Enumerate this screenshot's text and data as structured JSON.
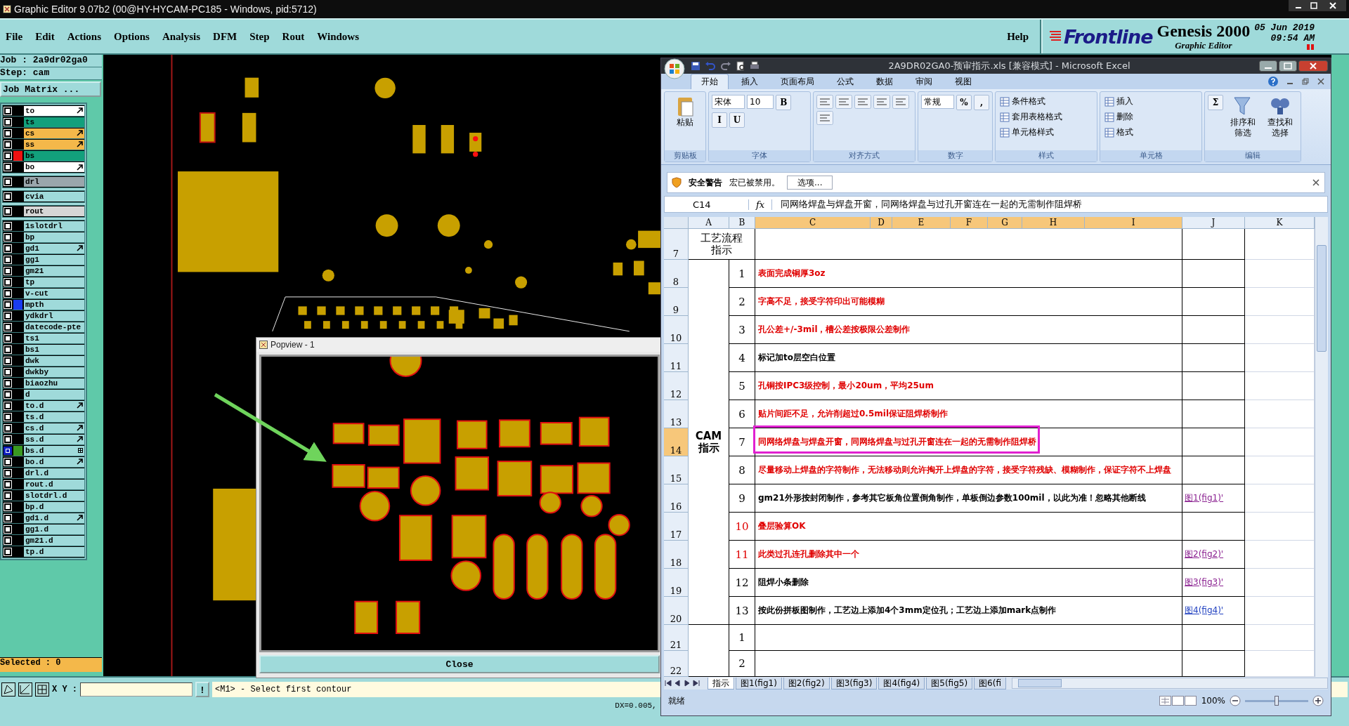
{
  "genesis": {
    "window": {
      "title": "Graphic Editor 9.07b2 (00@HY-HYCAM-PC185 - Windows, pid:5712)"
    },
    "menu": [
      "File",
      "Edit",
      "Actions",
      "Options",
      "Analysis",
      "DFM",
      "Step",
      "Rout",
      "Windows"
    ],
    "help": "Help",
    "brand": {
      "logo": "Frontline",
      "product": "Genesis 2000",
      "subtitle": "Graphic Editor",
      "date": "05 Jun 2019",
      "time": "09:54 AM"
    },
    "job": "Job : 2a9dr02ga0",
    "step": "Step: cam",
    "job_matrix": "Job Matrix ...",
    "layer_groups": [
      {
        "layers": [
          {
            "name": "to",
            "kind": "silk",
            "pointer": true,
            "selected": false
          },
          {
            "name": "ts",
            "kind": "mask",
            "pointer": false,
            "selected": false
          },
          {
            "name": "cs",
            "kind": "signal",
            "pointer": true,
            "selected": false
          },
          {
            "name": "ss",
            "kind": "signal",
            "pointer": true,
            "selected": false
          },
          {
            "name": "bs",
            "kind": "mask",
            "pointer": false,
            "color": "#ee1111",
            "selected": false
          },
          {
            "name": "bo",
            "kind": "silk",
            "pointer": true,
            "selected": false
          }
        ]
      },
      {
        "layers": [
          {
            "name": "drl",
            "kind": "drill",
            "pointer": false,
            "selected": false
          }
        ]
      },
      {
        "layers": [
          {
            "name": "cvia",
            "kind": "misc",
            "pointer": false,
            "selected": false
          }
        ]
      },
      {
        "layers": [
          {
            "name": "rout",
            "kind": "rout",
            "pointer": false,
            "selected": false
          }
        ]
      },
      {
        "layers": [
          {
            "name": "1slotdrl",
            "kind": "misc",
            "pointer": false,
            "selected": false
          },
          {
            "name": "bp",
            "kind": "misc",
            "pointer": false,
            "selected": false
          },
          {
            "name": "gd1",
            "kind": "misc",
            "pointer": true,
            "selected": false
          },
          {
            "name": "gg1",
            "kind": "misc",
            "pointer": false,
            "selected": false
          },
          {
            "name": "gm21",
            "kind": "misc",
            "pointer": false,
            "selected": false
          },
          {
            "name": "tp",
            "kind": "misc",
            "pointer": false,
            "selected": false
          },
          {
            "name": "v-cut",
            "kind": "misc",
            "pointer": false,
            "selected": false
          },
          {
            "name": "mpth",
            "kind": "misc",
            "pointer": false,
            "color": "#1a3cf0",
            "selected": false
          },
          {
            "name": "ydkdrl",
            "kind": "misc",
            "pointer": false,
            "selected": false
          },
          {
            "name": "datecode-pte",
            "kind": "misc",
            "pointer": false,
            "selected": false
          },
          {
            "name": "ts1",
            "kind": "misc",
            "pointer": false,
            "selected": false
          },
          {
            "name": "bs1",
            "kind": "misc",
            "pointer": false,
            "selected": false
          },
          {
            "name": "dwk",
            "kind": "misc",
            "pointer": false,
            "selected": false
          },
          {
            "name": "dwkby",
            "kind": "misc",
            "pointer": false,
            "selected": false
          },
          {
            "name": "biaozhu",
            "kind": "misc",
            "pointer": false,
            "selected": false
          },
          {
            "name": "d",
            "kind": "misc",
            "pointer": false,
            "selected": false
          },
          {
            "name": "to.d",
            "kind": "misc",
            "pointer": true,
            "selected": false
          },
          {
            "name": "ts.d",
            "kind": "misc",
            "pointer": false,
            "selected": false
          },
          {
            "name": "cs.d",
            "kind": "misc",
            "pointer": true,
            "selected": false
          },
          {
            "name": "ss.d",
            "kind": "misc",
            "pointer": true,
            "selected": false
          },
          {
            "name": "bs.d",
            "kind": "misc",
            "pointer": false,
            "color": "#3a9a20",
            "selected": true
          },
          {
            "name": "bo.d",
            "kind": "misc",
            "pointer": true,
            "selected": false
          },
          {
            "name": "drl.d",
            "kind": "misc",
            "pointer": false,
            "selected": false
          },
          {
            "name": "rout.d",
            "kind": "misc",
            "pointer": false,
            "selected": false
          },
          {
            "name": "slotdrl.d",
            "kind": "misc",
            "pointer": false,
            "selected": false
          },
          {
            "name": "bp.d",
            "kind": "misc",
            "pointer": false,
            "selected": false
          },
          {
            "name": "gd1.d",
            "kind": "misc",
            "pointer": true,
            "selected": false
          },
          {
            "name": "gg1.d",
            "kind": "misc",
            "pointer": false,
            "selected": false
          },
          {
            "name": "gm21.d",
            "kind": "misc",
            "pointer": false,
            "selected": false
          },
          {
            "name": "tp.d",
            "kind": "misc",
            "pointer": false,
            "selected": false
          }
        ]
      }
    ],
    "selected_count": "Selected : 0",
    "xy_label": "X Y :",
    "alert_key": "!",
    "prompt": "<M1> - Select first contour",
    "dx": "DX=0.005,"
  },
  "popview": {
    "title": "Popview - 1",
    "close": "Close"
  },
  "excel": {
    "title": "2A9DR02GA0-预审指示.xls  [兼容模式] - Microsoft Excel",
    "tabs": [
      {
        "label": "开始",
        "selected": true
      },
      {
        "label": "插入",
        "selected": false
      },
      {
        "label": "页面布局",
        "selected": false
      },
      {
        "label": "公式",
        "selected": false
      },
      {
        "label": "数据",
        "selected": false
      },
      {
        "label": "审阅",
        "selected": false
      },
      {
        "label": "视图",
        "selected": false
      }
    ],
    "ribbon_groups": [
      {
        "label": "剪贴板",
        "items": [
          {
            "kind": "big",
            "text": "粘贴"
          }
        ]
      },
      {
        "label": "字体",
        "items": [
          {
            "kind": "field",
            "text": "宋体"
          },
          {
            "kind": "field",
            "text": "10"
          },
          {
            "kind": "small",
            "text": "B"
          },
          {
            "kind": "small",
            "text": "I"
          },
          {
            "kind": "small",
            "text": "U"
          }
        ]
      },
      {
        "label": "对齐方式",
        "items": [
          {
            "kind": "icon"
          },
          {
            "kind": "icon"
          },
          {
            "kind": "icon"
          },
          {
            "kind": "icon"
          },
          {
            "kind": "icon"
          },
          {
            "kind": "icon"
          }
        ]
      },
      {
        "label": "数字",
        "items": [
          {
            "kind": "field",
            "text": "常规"
          },
          {
            "kind": "small",
            "text": "%"
          },
          {
            "kind": "small",
            "text": ","
          }
        ]
      },
      {
        "label": "样式",
        "items": [
          {
            "kind": "menu",
            "text": "条件格式"
          },
          {
            "kind": "menu",
            "text": "套用表格格式"
          },
          {
            "kind": "menu",
            "text": "单元格样式"
          }
        ]
      },
      {
        "label": "单元格",
        "items": [
          {
            "kind": "menu",
            "text": "插入"
          },
          {
            "kind": "menu",
            "text": "删除"
          },
          {
            "kind": "menu",
            "text": "格式"
          }
        ]
      },
      {
        "label": "编辑",
        "items": [
          {
            "kind": "small",
            "text": "Σ"
          },
          {
            "kind": "big",
            "text": "排序和筛选"
          },
          {
            "kind": "big",
            "text": "查找和选择"
          }
        ]
      }
    ],
    "security": {
      "title": "安全警告",
      "message": "宏已被禁用。",
      "button": "选项..."
    },
    "formula": {
      "cell": "C14",
      "fx": "fx",
      "value": "同网络焊盘与焊盘开窗，同网络焊盘与过孔开窗连在一起的无需制作阻焊桥"
    },
    "columns": [
      {
        "label": "A",
        "selected": false
      },
      {
        "label": "B",
        "selected": false
      },
      {
        "label": "C",
        "selected": true
      },
      {
        "label": "D",
        "selected": true
      },
      {
        "label": "E",
        "selected": true
      },
      {
        "label": "F",
        "selected": true
      },
      {
        "label": "G",
        "selected": true
      },
      {
        "label": "H",
        "selected": true
      },
      {
        "label": "I",
        "selected": true
      },
      {
        "label": "J",
        "selected": false
      },
      {
        "label": "K",
        "selected": false
      }
    ],
    "groups": [
      {
        "kind": "header",
        "title": "工艺流程指示",
        "rows": [
          {
            "number": "7",
            "selected": false,
            "annotated": false
          }
        ]
      },
      {
        "kind": "list",
        "title": "CAM 指示",
        "rows": [
          {
            "number": "8",
            "step": "1",
            "text": "表面完成铜厚3oz",
            "flagged": true,
            "number_flagged": false,
            "selected": false,
            "annotated": false
          },
          {
            "number": "9",
            "step": "2",
            "text": "字高不足，接受字符印出可能模糊",
            "flagged": true,
            "number_flagged": false,
            "selected": false,
            "annotated": false
          },
          {
            "number": "10",
            "step": "3",
            "text": "孔公差+/-3mil，槽公差按极限公差制作",
            "flagged": true,
            "number_flagged": false,
            "selected": false,
            "annotated": false
          },
          {
            "number": "11",
            "step": "4",
            "text": "标记加to层空白位置",
            "flagged": false,
            "number_flagged": false,
            "selected": false,
            "annotated": false
          },
          {
            "number": "12",
            "step": "5",
            "text": "孔铜按IPC3级控制，最小20um，平均25um",
            "flagged": true,
            "number_flagged": false,
            "selected": false,
            "annotated": false
          },
          {
            "number": "13",
            "step": "6",
            "text": "贴片间距不足，允许削超过0.5mil保证阻焊桥制作",
            "flagged": true,
            "number_flagged": false,
            "selected": false,
            "annotated": false
          },
          {
            "number": "14",
            "step": "7",
            "text": "同网络焊盘与焊盘开窗，同网络焊盘与过孔开窗连在一起的无需制作阻焊桥",
            "flagged": true,
            "number_flagged": false,
            "selected": true,
            "annotated": true
          },
          {
            "number": "15",
            "step": "8",
            "text": "尽量移动上焊盘的字符制作，无法移动则允许掏开上焊盘的字符，接受字符残缺、模糊制作，保证字符不上焊盘",
            "flagged": true,
            "number_flagged": false,
            "selected": false,
            "annotated": false
          },
          {
            "number": "16",
            "step": "9",
            "text": "gm21外形按封闭制作，参考其它板角位置倒角制作，单板倒边参数100mil，以此为准！忽略其他断线",
            "flagged": false,
            "number_flagged": false,
            "link": "图1(fig1)'",
            "visited": true,
            "selected": false,
            "annotated": false
          },
          {
            "number": "17",
            "step": "10",
            "text": "叠层验算OK",
            "flagged": true,
            "number_flagged": true,
            "selected": false,
            "annotated": false
          },
          {
            "number": "18",
            "step": "11",
            "text": "此类过孔连孔删除其中一个",
            "flagged": true,
            "number_flagged": true,
            "link": "图2(fig2)'",
            "visited": true,
            "selected": false,
            "annotated": false
          },
          {
            "number": "19",
            "step": "12",
            "text": "阻焊小条删除",
            "flagged": false,
            "number_flagged": false,
            "link": "图3(fig3)'",
            "visited": true,
            "selected": false,
            "annotated": false
          },
          {
            "number": "20",
            "step": "13",
            "text": "按此份拼板图制作，工艺边上添加4个3mm定位孔；工艺边上添加mark点制作",
            "flagged": false,
            "number_flagged": false,
            "link": "图4(fig4)'",
            "visited": false,
            "selected": false,
            "annotated": false
          }
        ]
      },
      {
        "kind": "list",
        "rows": [
          {
            "number": "21",
            "step": "1",
            "number_flagged": false,
            "selected": false,
            "annotated": false
          },
          {
            "number": "22",
            "step": "2",
            "number_flagged": false,
            "selected": false,
            "annotated": false
          }
        ]
      }
    ],
    "sheets": [
      {
        "label": "指示",
        "selected": true
      },
      {
        "label": "图1(fig1)",
        "selected": false
      },
      {
        "label": "图2(fig2)",
        "selected": false
      },
      {
        "label": "图3(fig3)",
        "selected": false
      },
      {
        "label": "图4(fig4)",
        "selected": false
      },
      {
        "label": "图5(fig5)",
        "selected": false
      },
      {
        "label": "图6(fi",
        "selected": false
      }
    ],
    "status": "就绪",
    "zoom": "100%",
    "zoom_slider": {
      "level": 0.5
    }
  }
}
